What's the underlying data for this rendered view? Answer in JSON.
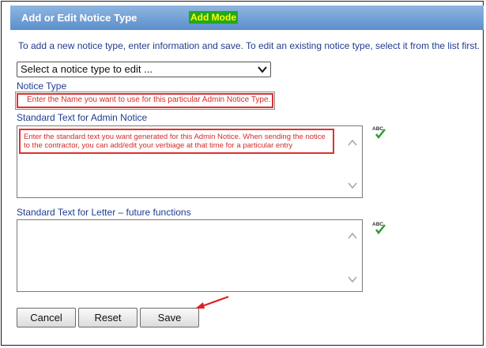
{
  "header": {
    "title": "Add or Edit Notice Type",
    "mode_badge": "Add Mode"
  },
  "intro_text": "To add a new notice type, enter information and save. To edit an existing notice type, select it from the list first.",
  "notice_select": {
    "selected": "Select a notice type to edit ..."
  },
  "notice_type": {
    "label": "Notice Type",
    "hint": "Enter the Name you want to use for this particular Admin Notice Type."
  },
  "admin_notice": {
    "label": "Standard Text for Admin Notice",
    "hint": "Enter the standard text you want generated for this Admin Notice.  When sending the notice to the contractor, you can add/edit your verbiage at that time for a particular entry"
  },
  "letter": {
    "label": "Standard Text for Letter – future functions"
  },
  "spellcheck": {
    "icon_text": "ABC"
  },
  "buttons": {
    "cancel": "Cancel",
    "reset": "Reset",
    "save": "Save"
  },
  "colors": {
    "header_gradient_top": "#8fb6e0",
    "header_gradient_bottom": "#5b8fcc",
    "badge_bg": "#22a81e",
    "badge_text": "#ffff00",
    "label_text": "#1f3c8f",
    "annotation_red": "#e03030"
  }
}
